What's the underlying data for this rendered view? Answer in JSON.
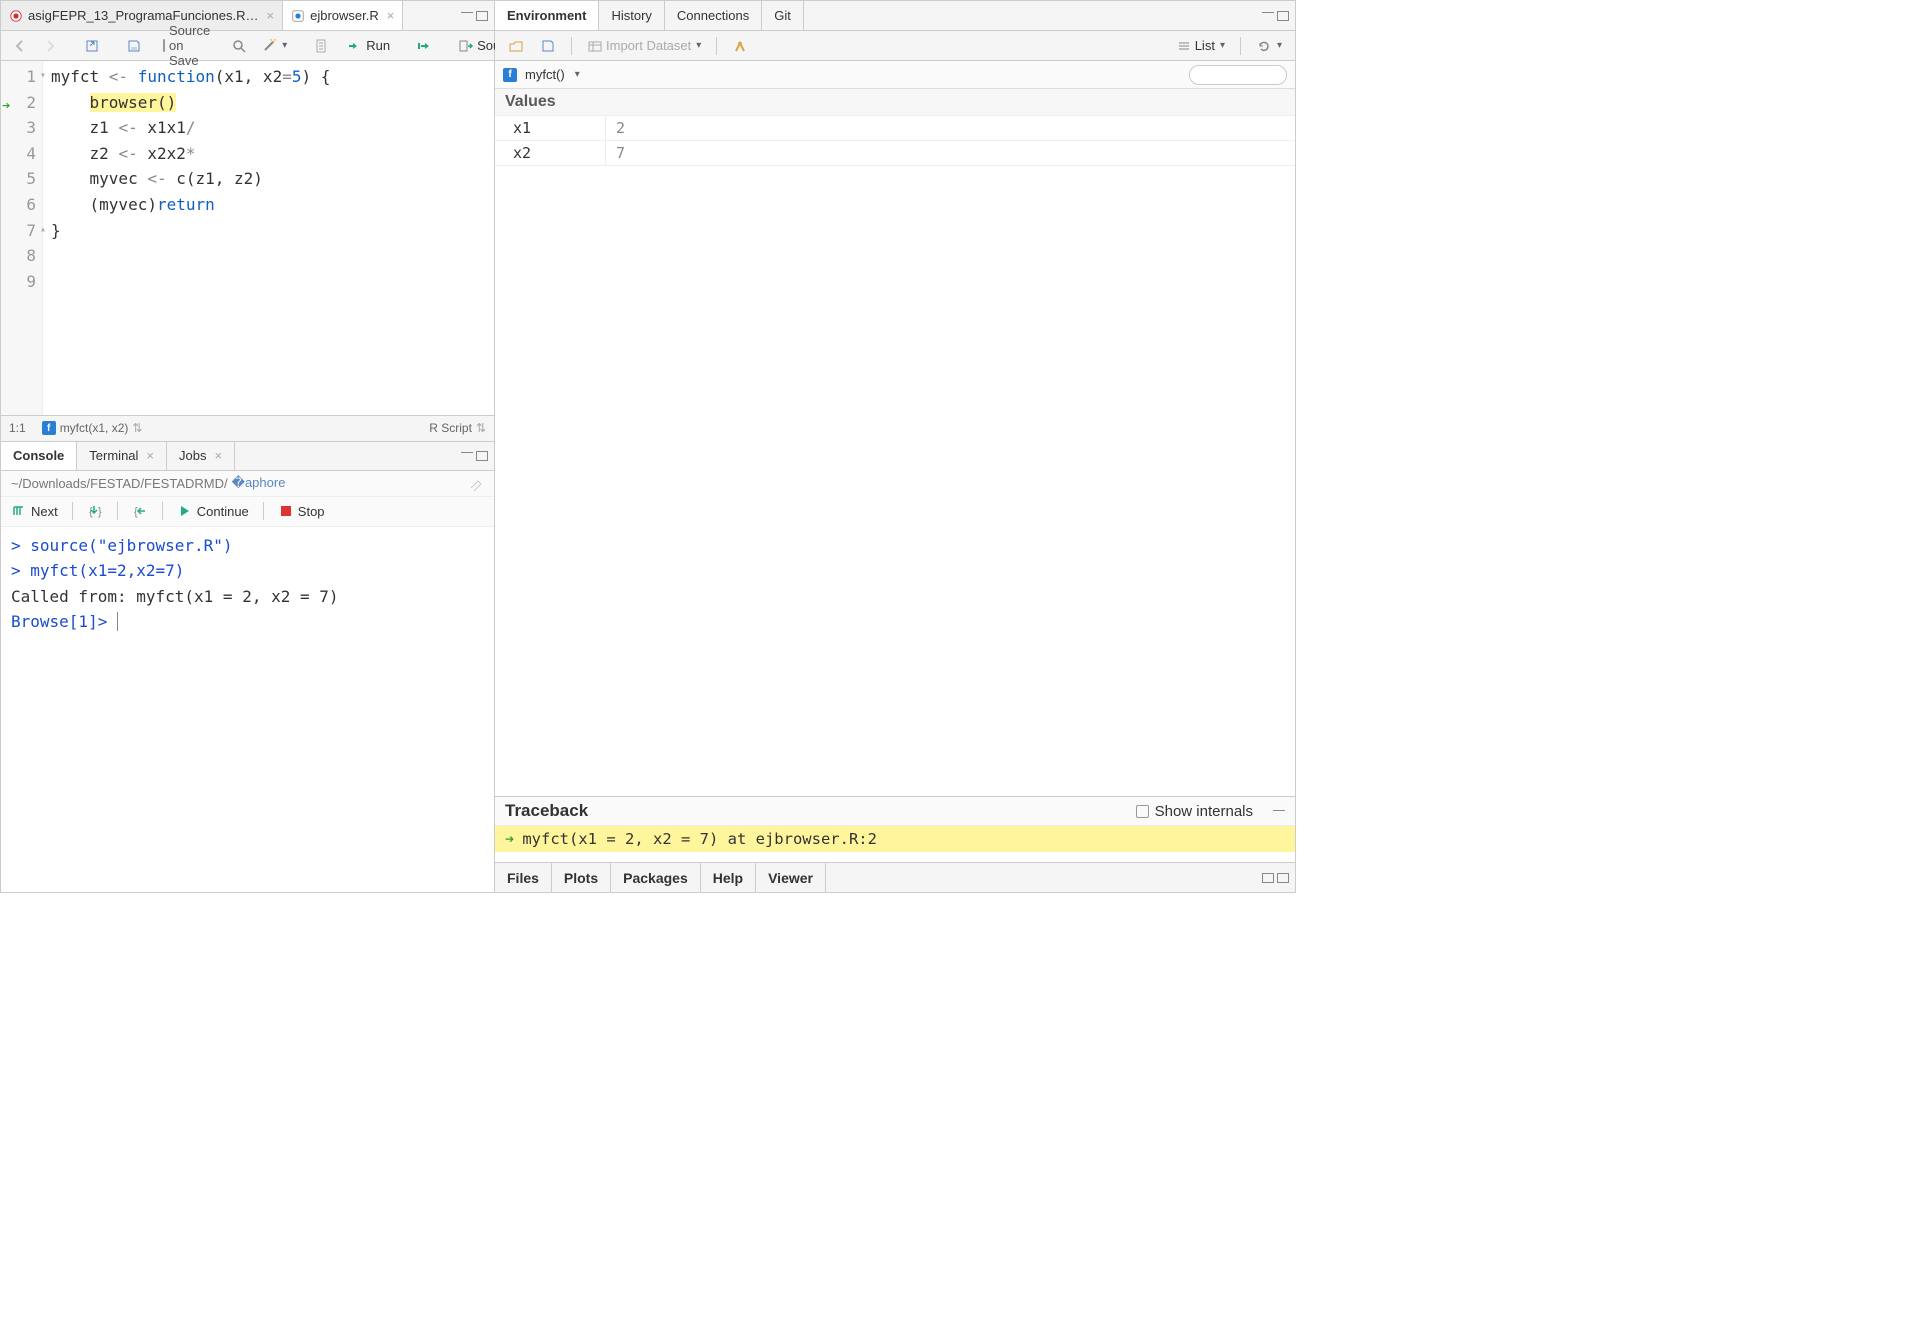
{
  "editor": {
    "tabs": [
      {
        "label": "asigFEPR_13_ProgramaFunciones.R…",
        "active": false
      },
      {
        "label": "ejbrowser.R",
        "active": true
      }
    ],
    "toolbar": {
      "source_on_save": "Source on Save",
      "run": "Run",
      "source_btn": "Source"
    },
    "gutter": [
      "1",
      "2",
      "3",
      "4",
      "5",
      "6",
      "7",
      "8",
      "9"
    ],
    "current_line_arrow": 2,
    "code_lines": [
      {
        "t": "myfct ",
        "op": "<-",
        "t2": " ",
        "kw": "function",
        "t3": "(x1, x2",
        "op2": "=",
        "num": "5",
        "t4": ") {"
      },
      {
        "indent": "    ",
        "hl": "browser()"
      },
      {
        "indent": "    ",
        "t": "z1 ",
        "op": "<-",
        "t2": " x1",
        "op2": "/",
        "t3": "x1"
      },
      {
        "indent": "    ",
        "t": "z2 ",
        "op": "<-",
        "t2": " x2",
        "op2": "*",
        "t3": "x2"
      },
      {
        "indent": "    ",
        "t": "myvec ",
        "op": "<-",
        "t2": " c(z1, z2)"
      },
      {
        "indent": "    ",
        "kw": "return",
        "t": "(myvec)"
      },
      {
        "t": "}"
      },
      {
        "t": ""
      },
      {
        "t": ""
      }
    ],
    "status": {
      "pos": "1:1",
      "scope": "myfct(x1, x2)",
      "lang": "R Script"
    }
  },
  "console": {
    "tabs": [
      "Console",
      "Terminal",
      "Jobs"
    ],
    "active_tab": "Console",
    "path": "~/Downloads/FESTAD/FESTADRMD/",
    "debug": {
      "next": "Next",
      "continue": "Continue",
      "stop": "Stop"
    },
    "lines": [
      {
        "prompt": "> ",
        "blue": "source(\"ejbrowser.R\")"
      },
      {
        "prompt": "> ",
        "blue": "myfct(x1=2,x2=7)"
      },
      {
        "plain": "Called from: myfct(x1 = 2, x2 = 7)"
      },
      {
        "blue": "Browse[1]> ",
        "cursor": true
      }
    ]
  },
  "environment": {
    "tabs": [
      "Environment",
      "History",
      "Connections",
      "Git"
    ],
    "active_tab": "Environment",
    "toolbar": {
      "import": "Import Dataset",
      "view": "List"
    },
    "scope": "myfct()",
    "section": "Values",
    "rows": [
      {
        "name": "x1",
        "value": "2"
      },
      {
        "name": "x2",
        "value": "7"
      }
    ]
  },
  "traceback": {
    "title": "Traceback",
    "show_internals": "Show internals",
    "rows": [
      {
        "text": "myfct(x1 = 2, x2 = 7) at ejbrowser.R:2"
      }
    ]
  },
  "bottom_tabs": [
    "Files",
    "Plots",
    "Packages",
    "Help",
    "Viewer"
  ]
}
